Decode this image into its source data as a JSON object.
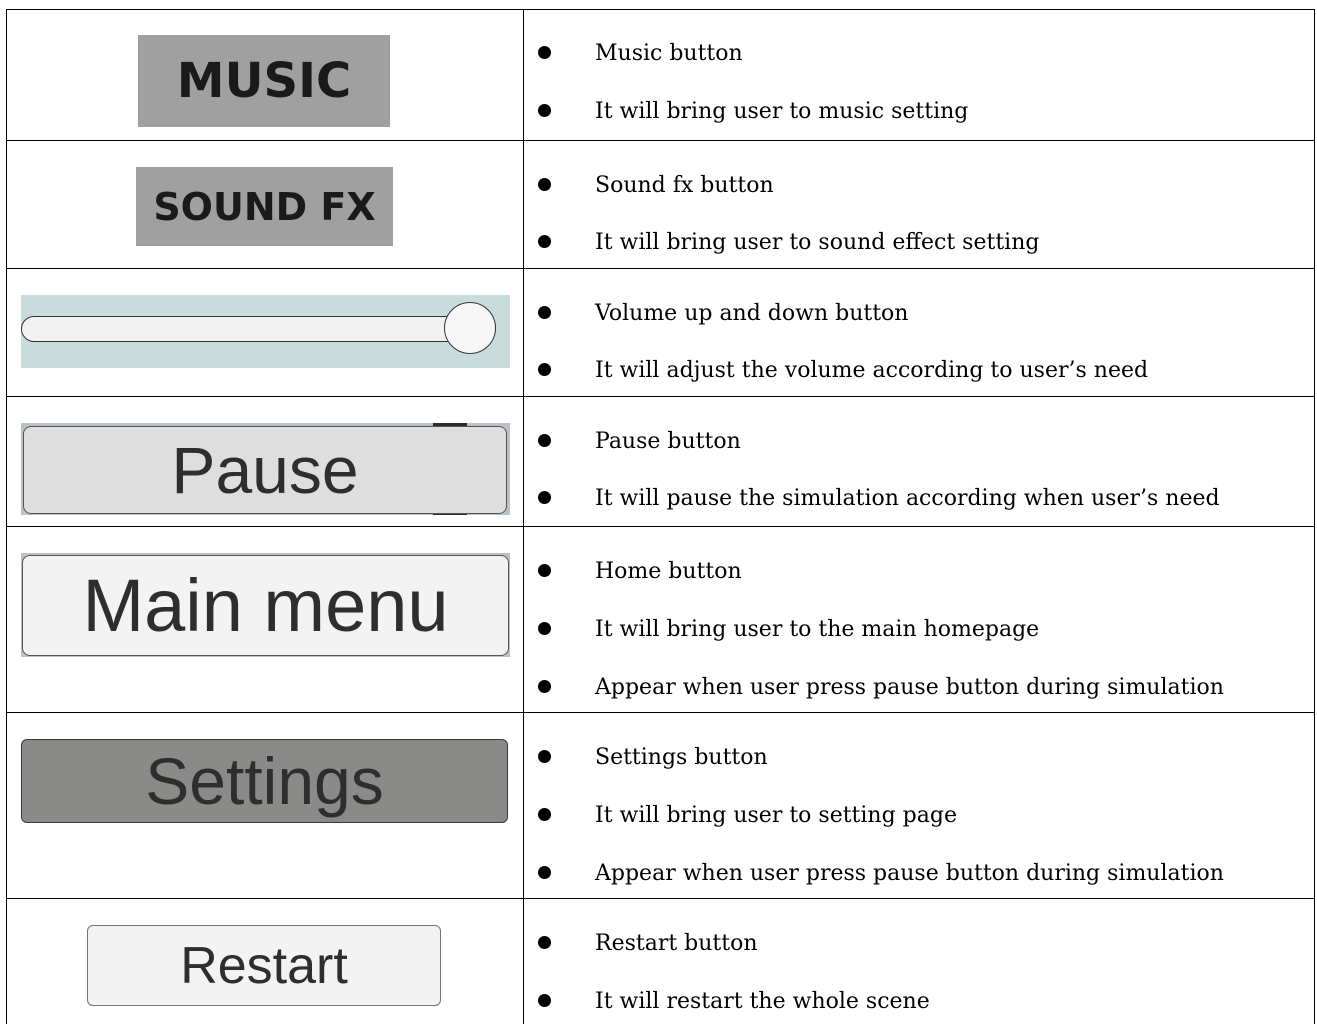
{
  "rows": [
    {
      "image_label": "MUSIC",
      "bullets": [
        "Music button",
        "It will bring user to music setting"
      ]
    },
    {
      "image_label": "SOUND FX",
      "bullets": [
        "Sound fx button",
        "It will bring user to sound effect setting"
      ]
    },
    {
      "image_label": "",
      "slider_value_percent": 100,
      "bullets": [
        "Volume up and down button",
        "It will adjust the volume according to user’s need"
      ]
    },
    {
      "image_label": "Pause",
      "bullets": [
        "Pause button",
        "It will pause the simulation according when user’s need"
      ]
    },
    {
      "image_label": "Main menu",
      "bullets": [
        "Home button",
        "It will bring user to the main homepage",
        "Appear when user press pause button during simulation"
      ]
    },
    {
      "image_label": "Settings",
      "bullets": [
        "Settings button",
        "It will bring user to setting page",
        "Appear when user press pause button during simulation"
      ]
    },
    {
      "image_label": "Restart",
      "bullets": [
        "Restart button",
        "It will restart the whole scene"
      ]
    }
  ],
  "colors": {
    "border": "#000000",
    "button_gray": "#a0a0a0",
    "settings_gray": "#8a8a88",
    "slider_bg": "#c8dcdc"
  },
  "icons": [
    "bullet-dot-icon",
    "slider-knob-icon"
  ]
}
